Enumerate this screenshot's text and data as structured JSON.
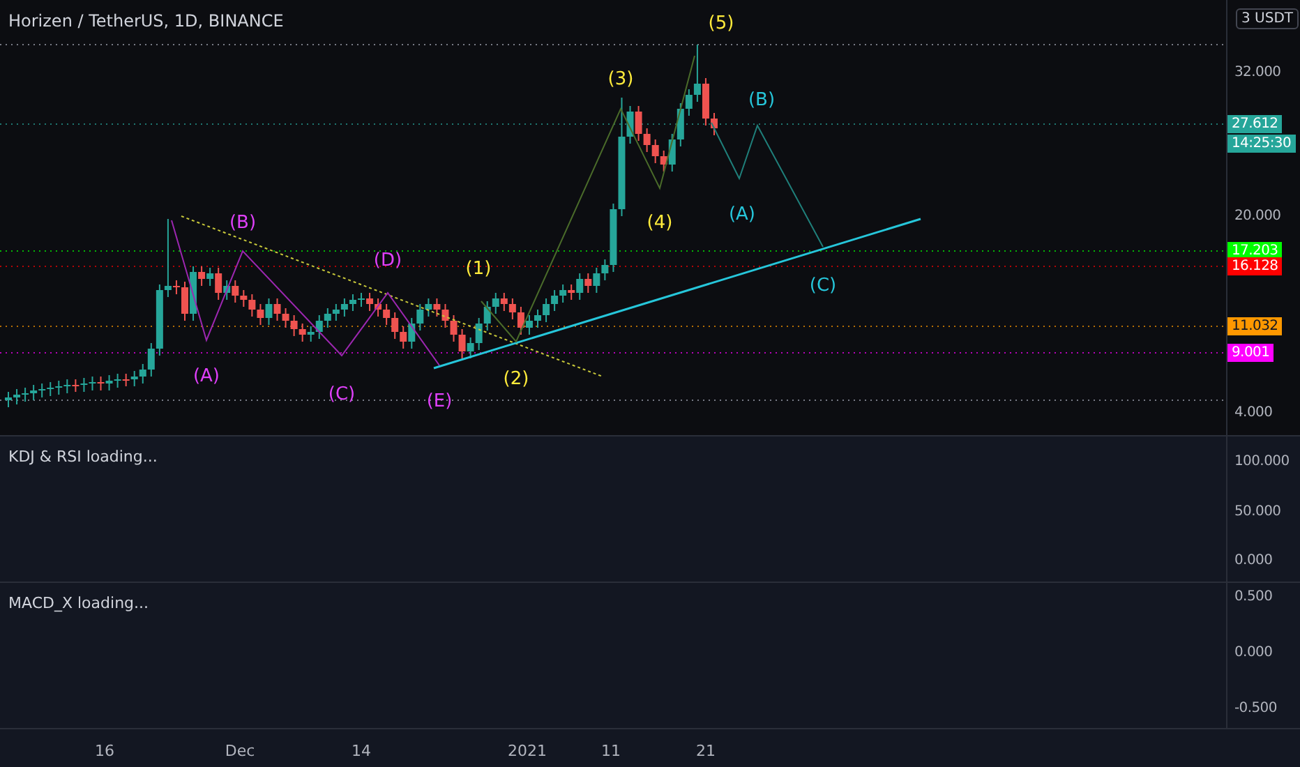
{
  "chart": {
    "title": "Horizen / TetherUS, 1D, BINANCE",
    "currency_button": "3 USDT",
    "price_ticks": [
      "32.000",
      "20.000",
      "4.000"
    ],
    "price_tags": [
      {
        "text": "27.612",
        "color": "#26a69a"
      },
      {
        "text": "17.203",
        "color": "#00ff00"
      },
      {
        "text": "16.128",
        "color": "#ff0000"
      },
      {
        "text": "11.032",
        "color": "#ff9800"
      },
      {
        "text": "9.001",
        "color": "#ff00ff"
      }
    ],
    "countdown": "14:25:30",
    "wave_groups": [
      {
        "color": "#e040fb",
        "labels": [
          "(A)",
          "(B)",
          "(C)",
          "(D)",
          "(E)"
        ]
      },
      {
        "color": "#ffeb3b",
        "labels": [
          "(1)",
          "(2)",
          "(3)",
          "(4)",
          "(5)"
        ]
      },
      {
        "color": "#26c6da",
        "labels": [
          "(A)",
          "(B)",
          "(C)"
        ]
      }
    ]
  },
  "indicators": [
    {
      "title": "KDJ & RSI loading...",
      "ticks": [
        "100.000",
        "50.000",
        "0.000"
      ]
    },
    {
      "title": "MACD_X loading...",
      "ticks": [
        "0.500",
        "0.000",
        "-0.500"
      ]
    }
  ],
  "time_axis": [
    "16",
    "Dec",
    "14",
    "2021",
    "11",
    "21"
  ]
}
